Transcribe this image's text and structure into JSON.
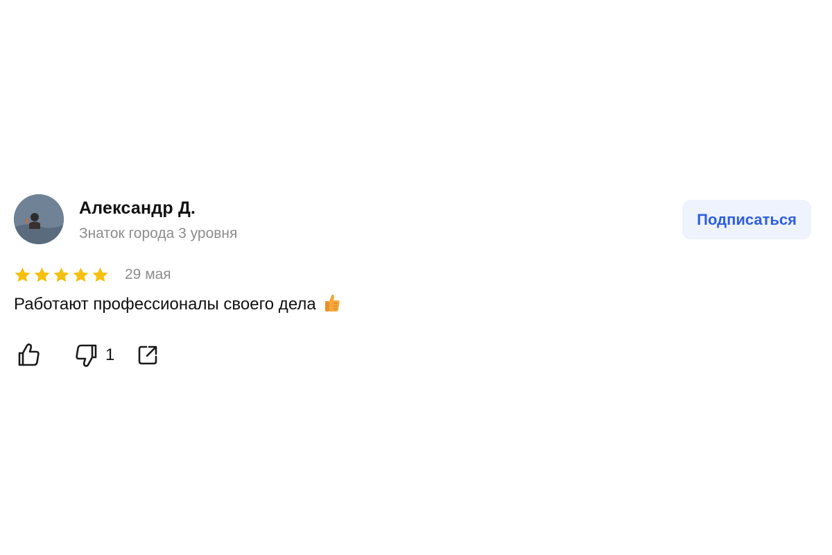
{
  "review": {
    "author": {
      "name": "Александр Д.",
      "level": "Знаток города 3 уровня",
      "avatar_icon": "user-photo-avatar"
    },
    "subscribe_label": "Подписаться",
    "rating": 5,
    "rating_max": 5,
    "date": "29 мая",
    "text": "Работают профессионалы своего дела",
    "text_emoji_icon": "thumbs-up-emoji",
    "actions": {
      "like_icon": "thumbs-up-icon",
      "dislike_icon": "thumbs-down-icon",
      "dislike_count": "1",
      "share_icon": "share-icon"
    }
  },
  "colors": {
    "star": "#f5c00e",
    "subscribe_bg": "#eef3fd",
    "subscribe_text": "#2f5fe0",
    "secondary_text": "#8c8c8c"
  }
}
